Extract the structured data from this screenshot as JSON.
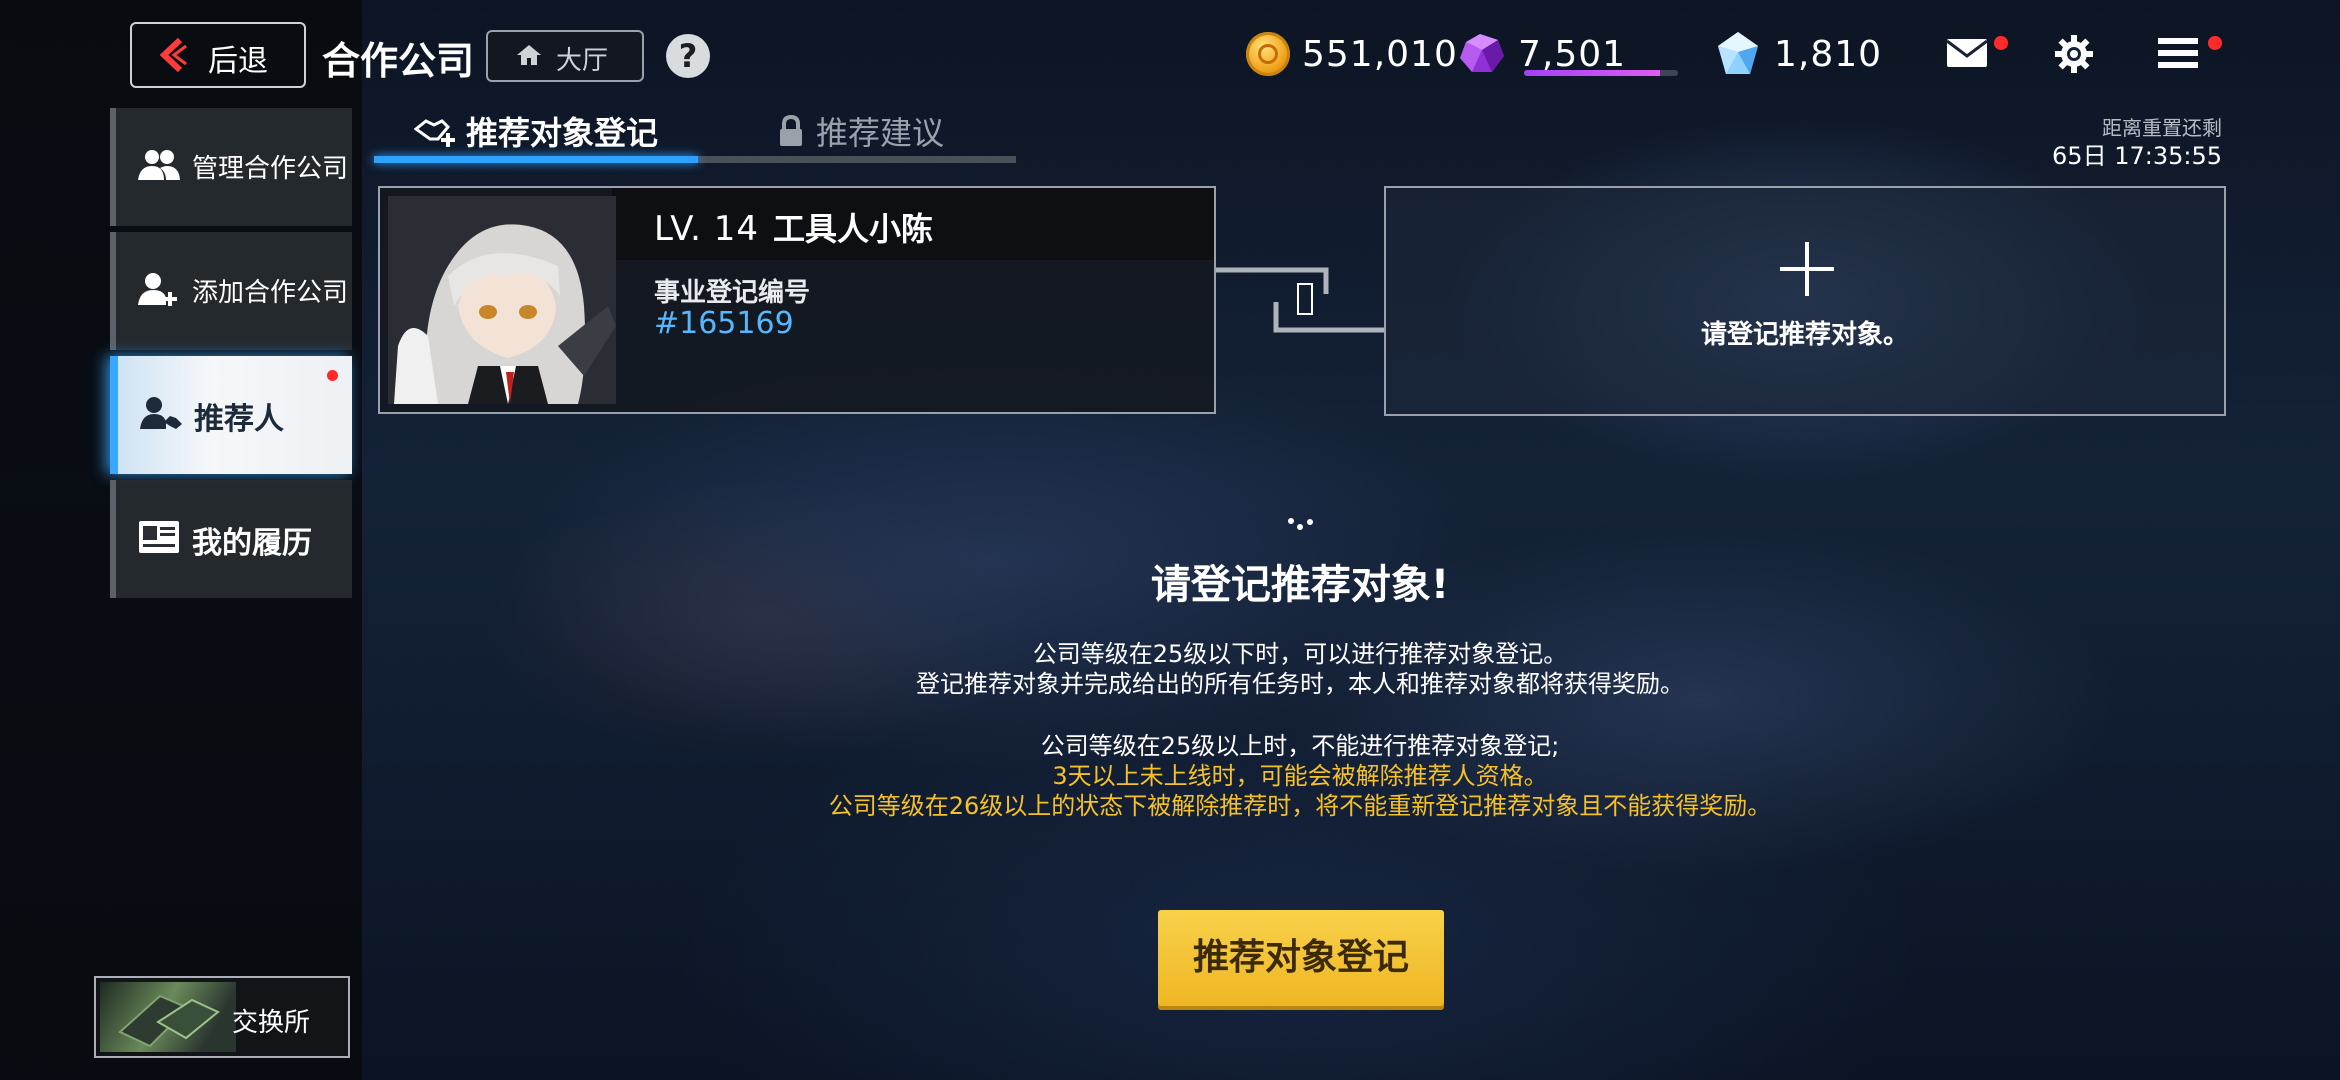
{
  "topbar": {
    "back_label": "后退",
    "title": "合作公司",
    "lobby_label": "大厅",
    "help_glyph": "?",
    "gold_value": "551,010",
    "purple_gem_value": "7,501",
    "purple_gem_fill": 0.88,
    "blue_gem_value": "1,810",
    "icons": [
      "back-chevron-icon",
      "home-icon",
      "help-icon",
      "gold-coin-icon",
      "purple-gem-icon",
      "blue-gem-icon",
      "mail-icon",
      "gear-icon",
      "menu-icon"
    ],
    "mail_badge": true,
    "menu_badge": true
  },
  "sidebar": {
    "items": [
      {
        "label": "管理合作公司",
        "icon": "manage-users-icon"
      },
      {
        "label": "添加合作公司",
        "icon": "add-user-icon"
      },
      {
        "label": "推荐人",
        "icon": "recommender-icon",
        "active": true,
        "badge": true
      },
      {
        "label": "我的履历",
        "icon": "resume-card-icon"
      }
    ],
    "exchange_label": "交换所"
  },
  "tabs": [
    {
      "label": "推荐对象登记",
      "icon": "handshake-plus-icon",
      "active": true
    },
    {
      "label": "推荐建议",
      "icon": "lock-icon",
      "active": false
    }
  ],
  "reset": {
    "label": "距离重置还剩",
    "time": "65日 17:35:55"
  },
  "user_card": {
    "level": "LV. 14",
    "name": "工具人小陈",
    "reg_label": "事业登记编号",
    "reg_number": "#165169"
  },
  "empty_card": {
    "text": "请登记推荐对象。"
  },
  "info": {
    "title": "请登记推荐对象!",
    "lines": [
      "公司等级在25级以下时，可以进行推荐对象登记。",
      "登记推荐对象并完成给出的所有任务时，本人和推荐对象都将获得奖励。",
      "公司等级在25级以上时，不能进行推荐对象登记;",
      "3天以上未上线时，可能会被解除推荐人资格。",
      "公司等级在26级以上的状态下被解除推荐时，将不能重新登记推荐对象且不能获得奖励。"
    ]
  },
  "register_button": "推荐对象登记",
  "colors": {
    "accent_blue": "#2fa2ff",
    "warning_yellow": "#f5c12a",
    "button_yellow": "#f3c431",
    "badge_red": "#ff2b2b"
  }
}
